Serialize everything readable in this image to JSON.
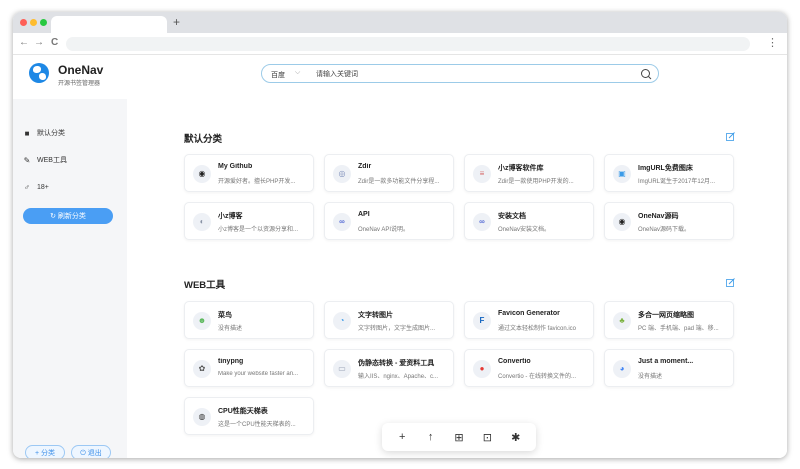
{
  "browser": {
    "new_tab": "+",
    "back": "←",
    "forward": "→",
    "reload": "C",
    "menu": "⋮"
  },
  "logo": {
    "title": "OneNav",
    "subtitle": "开源书签管理器"
  },
  "sidebar": {
    "items": [
      {
        "icon": "book-icon",
        "glyph": "■",
        "label": "默认分类"
      },
      {
        "icon": "wrench-icon",
        "glyph": "✎",
        "label": "WEB工具"
      },
      {
        "icon": "mars-icon",
        "glyph": "♂",
        "label": "18+"
      }
    ],
    "refresh_label": "↻ 刷新分类",
    "add_label": "+ 分类",
    "logout_label": "⏻ 退出"
  },
  "search": {
    "engine": "百度",
    "engine_caret": "⌵",
    "placeholder": "请输入关键词"
  },
  "sections": [
    {
      "title": "默认分类",
      "cards": [
        {
          "title": "My Github",
          "desc": "开源爱好者。擅长PHP开发...",
          "icon": "github-icon",
          "glyph": "◉",
          "color": "#222222"
        },
        {
          "title": "Zdir",
          "desc": "Zdir是一款多功能文件分享程...",
          "icon": "zdir-icon",
          "glyph": "◎",
          "color": "#7a8bb8"
        },
        {
          "title": "小z博客软件库",
          "desc": "Zdir是一款使用PHP开发的...",
          "icon": "document-icon",
          "glyph": "≡",
          "color": "#d66b6b"
        },
        {
          "title": "ImgURL免费图床",
          "desc": "ImgURL诞生于2017年12月...",
          "icon": "image-icon",
          "glyph": "▣",
          "color": "#3b9be8"
        },
        {
          "title": "小z博客",
          "desc": "小z博客是一个以资源分享和...",
          "icon": "blog-icon",
          "glyph": "◐",
          "color": "#8a94a6"
        },
        {
          "title": "API",
          "desc": "OneNav API说明。",
          "icon": "api-icon",
          "glyph": "∞",
          "color": "#5a6fd6"
        },
        {
          "title": "安装文档",
          "desc": "OneNav安装文档。",
          "icon": "link-icon",
          "glyph": "∞",
          "color": "#5a6fd6"
        },
        {
          "title": "OneNav源码",
          "desc": "OneNav源码下载。",
          "icon": "github-icon",
          "glyph": "◉",
          "color": "#222222"
        }
      ]
    },
    {
      "title": "WEB工具",
      "cards": [
        {
          "title": "菜鸟",
          "desc": "没有描述",
          "icon": "runoob-icon",
          "glyph": "☻",
          "color": "#5cb85c"
        },
        {
          "title": "文字转图片",
          "desc": "文字转图片，文字生成图片...",
          "icon": "text-image-icon",
          "glyph": "◔",
          "color": "#3b9be8"
        },
        {
          "title": "Favicon Generator",
          "desc": "通过文本轻松制作 favicon.ico",
          "icon": "favicon-icon",
          "glyph": "F",
          "color": "#1565c0"
        },
        {
          "title": "多合一网页缩略图",
          "desc": "PC 端、手机端、pad 端、移...",
          "icon": "thumbnail-icon",
          "glyph": "♣",
          "color": "#7cb342"
        },
        {
          "title": "tinypng",
          "desc": "Make your website faster an...",
          "icon": "panda-icon",
          "glyph": "✿",
          "color": "#555555"
        },
        {
          "title": "伪静态转换 - 爱资料工具",
          "desc": "输入IIS、nginx、Apache、c...",
          "icon": "tool-icon",
          "glyph": "▭",
          "color": "#9aa3b5"
        },
        {
          "title": "Convertio",
          "desc": "Convertio - 在线转换文件的...",
          "icon": "convertio-icon",
          "glyph": "●",
          "color": "#e53935"
        },
        {
          "title": "Just a moment...",
          "desc": "没有描述",
          "icon": "cloudflare-icon",
          "glyph": "◕",
          "color": "#4285f4"
        },
        {
          "title": "CPU性能天梯表",
          "desc": "这是一个CPU性能天梯表的...",
          "icon": "cpu-icon",
          "glyph": "◍",
          "color": "#333333"
        }
      ]
    }
  ],
  "toolbar": [
    {
      "icon": "plus-icon",
      "glyph": "+"
    },
    {
      "icon": "arrow-up-icon",
      "glyph": "↑"
    },
    {
      "icon": "gift-icon",
      "glyph": "⊞"
    },
    {
      "icon": "presentation-icon",
      "glyph": "⊡"
    },
    {
      "icon": "gear-icon",
      "glyph": "✱"
    }
  ]
}
